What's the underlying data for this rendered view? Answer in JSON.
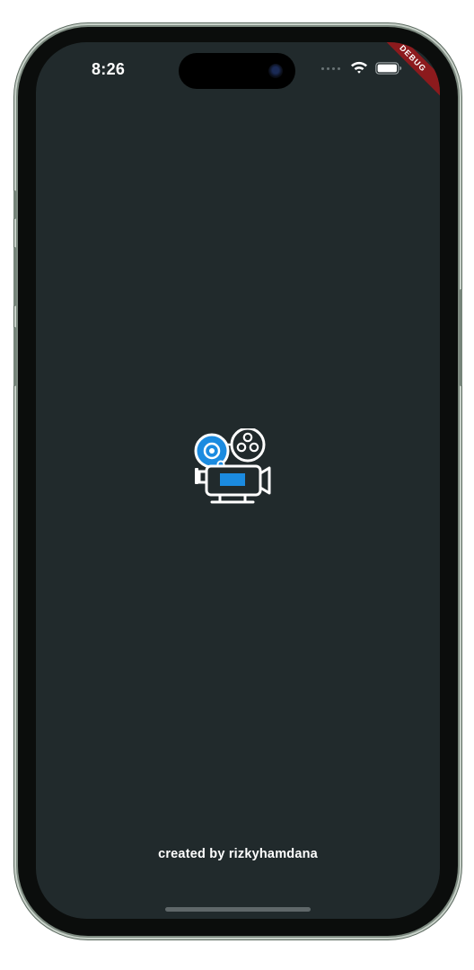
{
  "status_bar": {
    "time": "8:26",
    "signal_icon": "signal-dots-icon",
    "wifi_icon": "wifi-icon",
    "battery_icon": "battery-icon"
  },
  "debug_banner": {
    "label": "DEBUG",
    "color": "#8c1a1d"
  },
  "splash": {
    "logo_icon": "film-projector-icon",
    "credit": "created by rizkyhamdana",
    "background_color": "#212a2c",
    "accent_color": "#1b8be0"
  }
}
